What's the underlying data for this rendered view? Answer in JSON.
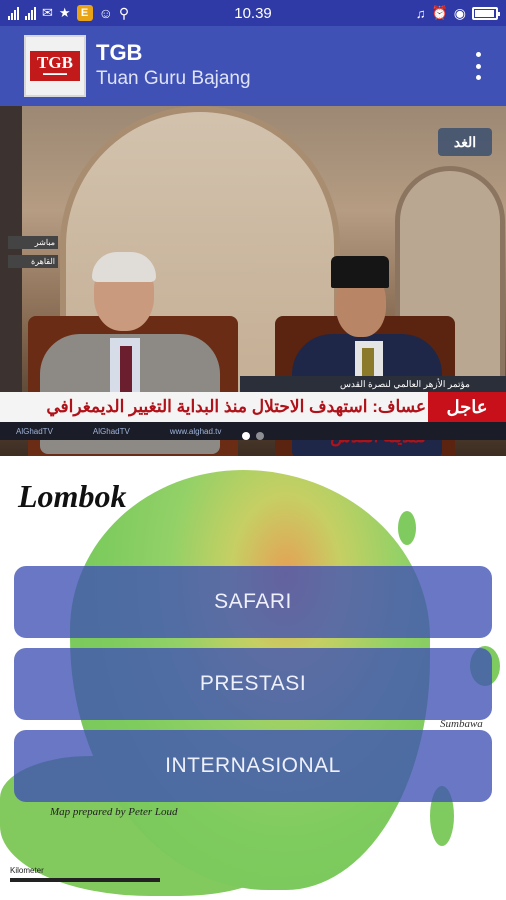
{
  "status_bar": {
    "time": "10.39",
    "battery_level": 0.85,
    "badge_letter": "E"
  },
  "app_bar": {
    "logo_text": "TGB",
    "title": "TGB",
    "subtitle": "Tuan Guru Bajang"
  },
  "slider": {
    "channel": "الغد",
    "ticker_flag": "عاجل",
    "ticker_headline": "عساف: استهدف الاحتلال منذ البداية التغيير الديمغرافي لمدينة القدس",
    "ticker_caption": "مؤتمر الأزهر العالمي لنصرة القدس",
    "ticker_bottom": [
      "AlGhadTV",
      "AlGhadTV",
      "www.alghad.tv"
    ],
    "left_tags": [
      "مباشر",
      "القاهرة"
    ],
    "page_count": 2,
    "active_page": 0
  },
  "map": {
    "title": "Lombok",
    "credit": "Map prepared by Peter Loud",
    "scale_label": "Kilometer",
    "place_labels": [
      "Sumbawa"
    ]
  },
  "menu": {
    "items": [
      {
        "label": "SAFARI"
      },
      {
        "label": "PRESTASI"
      },
      {
        "label": "INTERNASIONAL"
      }
    ]
  },
  "colors": {
    "status_bar": "#2f3aa6",
    "app_bar": "#3f51b5",
    "menu_button": "#3f51b5"
  }
}
